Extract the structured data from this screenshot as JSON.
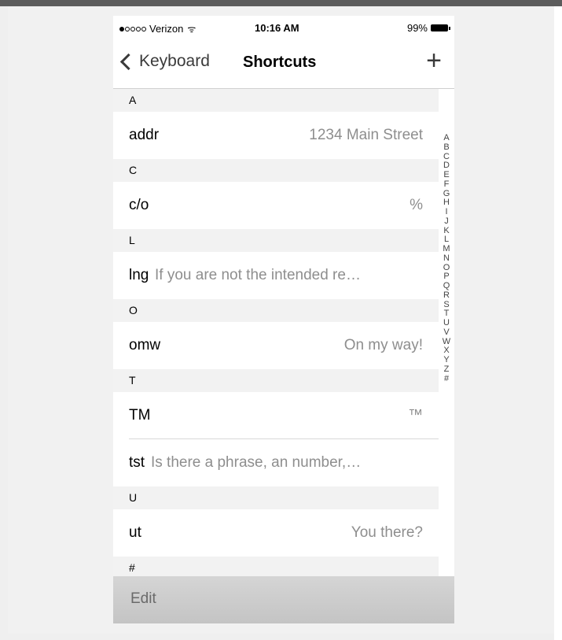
{
  "status_bar": {
    "carrier": "Verizon",
    "time": "10:16 AM",
    "battery": "99%"
  },
  "nav": {
    "back_label": "Keyboard",
    "title": "Shortcuts",
    "add_label": "+"
  },
  "sections": [
    {
      "letter": "A",
      "rows": [
        {
          "shortcut": "addr",
          "phrase": "1234 Main Street",
          "align": "right"
        }
      ]
    },
    {
      "letter": "C",
      "rows": [
        {
          "shortcut": "c/o",
          "phrase": "%",
          "align": "right"
        }
      ]
    },
    {
      "letter": "L",
      "rows": [
        {
          "shortcut": "lng",
          "phrase": "If you are not the intended re…",
          "align": "left"
        }
      ]
    },
    {
      "letter": "O",
      "rows": [
        {
          "shortcut": "omw",
          "phrase": "On my way!",
          "align": "right"
        }
      ]
    },
    {
      "letter": "T",
      "rows": [
        {
          "shortcut": "TM",
          "phrase": "™",
          "align": "right"
        },
        {
          "shortcut": "tst",
          "phrase": "Is there a phrase, an number,…",
          "align": "left"
        }
      ]
    },
    {
      "letter": "U",
      "rows": [
        {
          "shortcut": "ut",
          "phrase": "You there?",
          "align": "right"
        }
      ]
    },
    {
      "letter": "#",
      "rows": []
    }
  ],
  "index_letters": [
    "A",
    "B",
    "C",
    "D",
    "E",
    "F",
    "G",
    "H",
    "I",
    "J",
    "K",
    "L",
    "M",
    "N",
    "O",
    "P",
    "Q",
    "R",
    "S",
    "T",
    "U",
    "V",
    "W",
    "X",
    "Y",
    "Z",
    "#"
  ],
  "toolbar": {
    "edit_label": "Edit"
  },
  "colors": {
    "background": "#efefef",
    "section_header": "#f2f2f2",
    "text_secondary": "#8e8e8e",
    "toolbar": "#c9c9c9"
  },
  "icons": {
    "back": "chevron-left-icon",
    "add": "plus-icon",
    "wifi": "wifi-icon",
    "battery": "battery-icon",
    "signal": "signal-dots-icon"
  }
}
